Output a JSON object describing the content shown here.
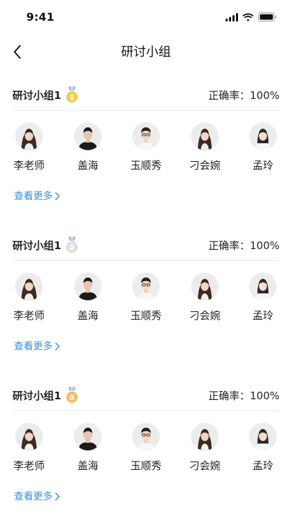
{
  "status_bar": {
    "time": "9:41"
  },
  "nav": {
    "title": "研讨小组"
  },
  "colors": {
    "link": "#3a8fd9",
    "gold": "#f2c232",
    "silver": "#d6d6d6",
    "bronze": "#f0b35a",
    "ribbon": "#7fb2e3"
  },
  "groups": [
    {
      "name": "研讨小组1",
      "medal_rank": "1",
      "accuracy_label": "正确率：",
      "accuracy_value": "100%",
      "members": [
        {
          "name": "李老师",
          "avatar": "woman-long-hair"
        },
        {
          "name": "盖海",
          "avatar": "man-dark-shirt"
        },
        {
          "name": "玉顺秀",
          "avatar": "man-glasses"
        },
        {
          "name": "刁会婉",
          "avatar": "woman-long-hair"
        },
        {
          "name": "孟玲",
          "avatar": "woman-short-hair"
        }
      ],
      "see_more": "查看更多"
    },
    {
      "name": "研讨小组1",
      "medal_rank": "2",
      "accuracy_label": "正确率：",
      "accuracy_value": "100%",
      "members": [
        {
          "name": "李老师",
          "avatar": "woman-long-hair"
        },
        {
          "name": "盖海",
          "avatar": "man-dark-shirt"
        },
        {
          "name": "玉顺秀",
          "avatar": "man-glasses"
        },
        {
          "name": "刁会婉",
          "avatar": "woman-long-hair"
        },
        {
          "name": "孟玲",
          "avatar": "woman-short-hair"
        }
      ],
      "see_more": "查看更多"
    },
    {
      "name": "研讨小组1",
      "medal_rank": "3",
      "accuracy_label": "正确率：",
      "accuracy_value": "100%",
      "members": [
        {
          "name": "李老师",
          "avatar": "woman-long-hair"
        },
        {
          "name": "盖海",
          "avatar": "man-dark-shirt"
        },
        {
          "name": "玉顺秀",
          "avatar": "man-glasses"
        },
        {
          "name": "刁会婉",
          "avatar": "woman-long-hair"
        },
        {
          "name": "孟玲",
          "avatar": "woman-short-hair"
        }
      ],
      "see_more": "查看更多"
    }
  ]
}
